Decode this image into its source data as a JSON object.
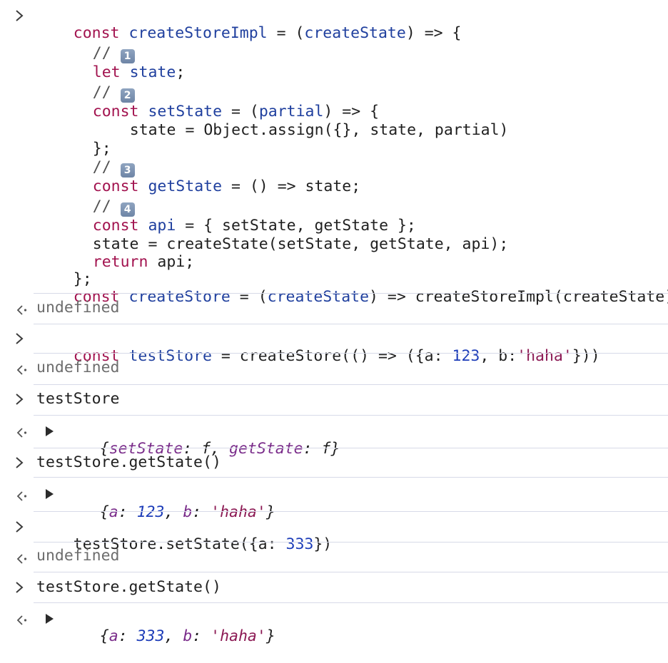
{
  "code": {
    "line1": {
      "kw": "const",
      "name": "createStoreImpl",
      "eq": " = (",
      "param": "createState",
      "rest": ") => {"
    },
    "c1": {
      "slashes": "// ",
      "badge": "1"
    },
    "line2": {
      "kw": "let",
      "name": "state",
      "rest": ";"
    },
    "c2": {
      "slashes": "// ",
      "badge": "2"
    },
    "line3": {
      "kw": "const",
      "name": "setState",
      "eq": " = (",
      "param": "partial",
      "rest": ") => {"
    },
    "line4": {
      "text": "state = Object.assign({}, state, partial)"
    },
    "line5": {
      "text": "};"
    },
    "c3": {
      "slashes": "// ",
      "badge": "3"
    },
    "line6": {
      "kw": "const",
      "name": "getState",
      "rest": " = () => state;"
    },
    "c4": {
      "slashes": "// ",
      "badge": "4"
    },
    "line7": {
      "kw": "const",
      "name": "api",
      "rest": " = { setState, getState };"
    },
    "line8": {
      "text": "state = createState(setState, getState, api);"
    },
    "line9": {
      "kw": "return",
      "rest": " api;"
    },
    "line10": {
      "text": "};"
    },
    "line11": {
      "kw": "const",
      "name": "createStore",
      "eq": " = (",
      "param": "createState",
      "rest": ") => createStoreImpl(createState);"
    }
  },
  "results": {
    "undefined": "undefined"
  },
  "input2": {
    "kw": "const",
    "name": "testStore",
    "a": " = createStore(() => ({a: ",
    "num": "123",
    "b": ", b:",
    "str": "'haha'",
    "c": "}))"
  },
  "input3": {
    "text": "testStore"
  },
  "output3": {
    "open": "{",
    "k1": "setState",
    "colon1": ": ",
    "v1": "f",
    "comma": ", ",
    "k2": "getState",
    "colon2": ": ",
    "v2": "f",
    "close": "}"
  },
  "input4": {
    "text": "testStore.getState()"
  },
  "output4": {
    "open": "{",
    "k1": "a",
    "colon1": ": ",
    "num": "123",
    "comma": ", ",
    "k2": "b",
    "colon2": ": ",
    "str": "'haha'",
    "close": "}"
  },
  "input5": {
    "a": "testStore.setState({a: ",
    "num": "333",
    "b": "})"
  },
  "input6": {
    "text": "testStore.getState()"
  },
  "output6": {
    "open": "{",
    "k1": "a",
    "colon1": ": ",
    "num": "333",
    "comma": ", ",
    "k2": "b",
    "colon2": ": ",
    "str": "'haha'",
    "close": "}"
  },
  "icons": {
    "prompt": "chevron-right-icon",
    "result": "return-arrow-icon",
    "expand": "disclosure-triangle-icon"
  },
  "colors": {
    "keyword": "#a2134f",
    "declaration": "#1f3f9e",
    "number": "#1c3cb8",
    "string": "#8c1a54",
    "separator": "#d7dae8"
  }
}
